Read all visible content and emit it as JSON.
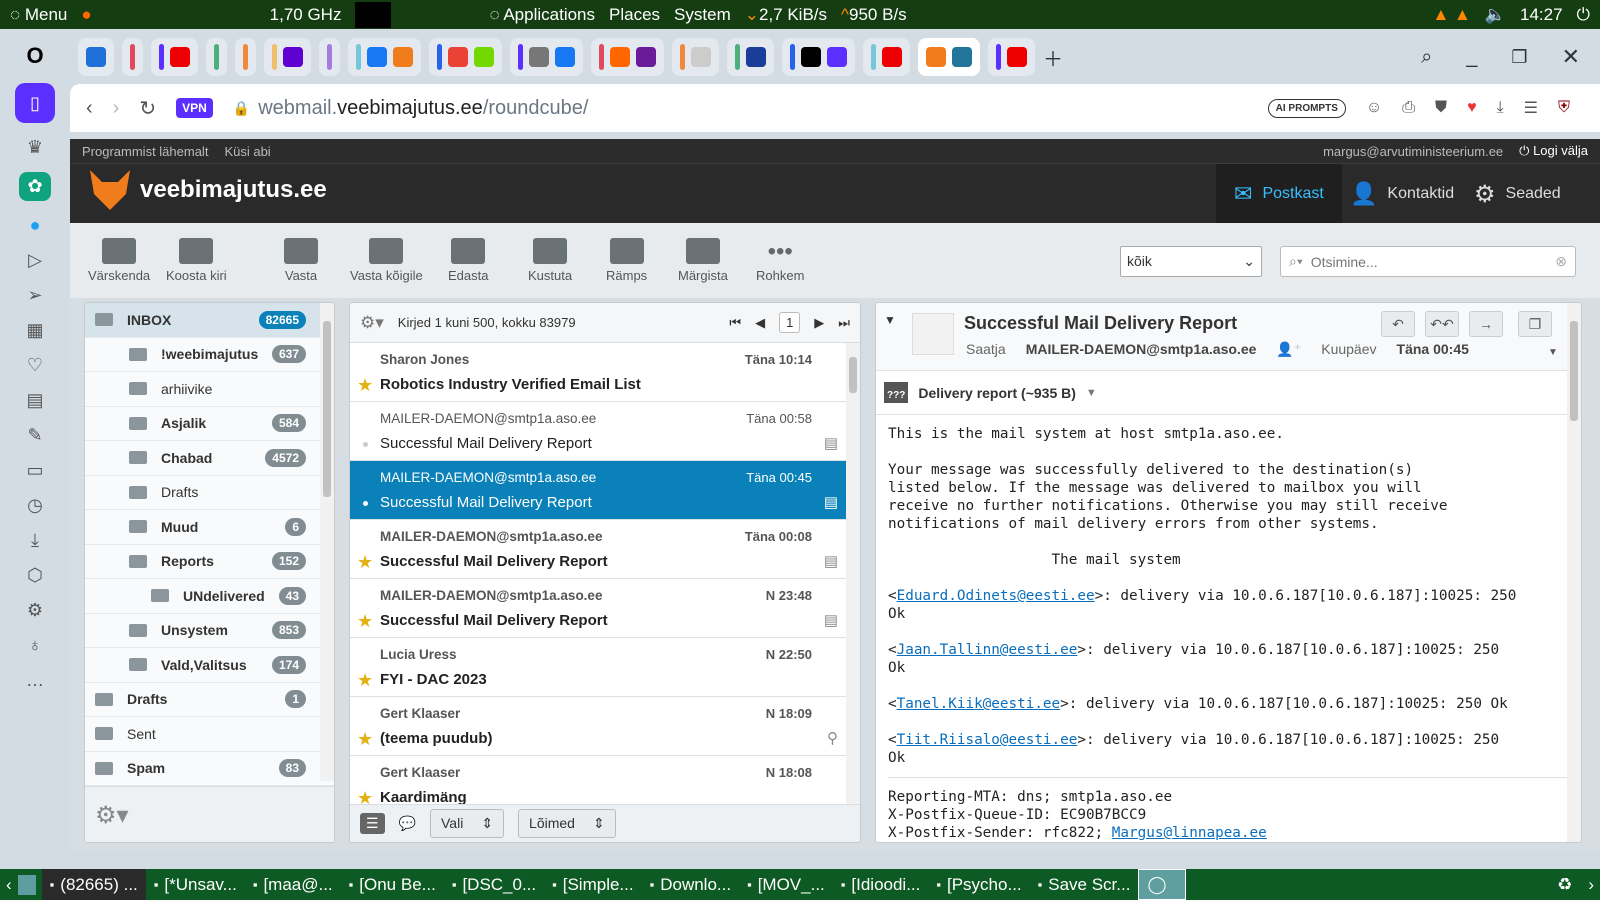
{
  "top_panel": {
    "menu": "Menu",
    "cpu": "1,70 GHz",
    "applications": "Applications",
    "places": "Places",
    "system": "System",
    "net": "2,7 KiB/s",
    "up": "950 B/s",
    "clock": "14:27"
  },
  "browser": {
    "vpn": "VPN",
    "url_pre": "webmail.",
    "url_host": "veebimajutus.ee",
    "url_path": "/roundcube/",
    "ai_prompts": "AI PROMPTS"
  },
  "rc_top": {
    "about": "Programmist lähemalt",
    "help": "Küsi abi",
    "user": "margus@arvutiministeerium.ee",
    "logout": "Logi välja"
  },
  "header": {
    "logo": "veebimajutus.ee",
    "nav": [
      "Postkast",
      "Kontaktid",
      "Seaded"
    ]
  },
  "toolbar": {
    "buttons": [
      "Värskenda",
      "Koosta kiri",
      "Vasta",
      "Vasta kõigile",
      "Edasta",
      "Kustuta",
      "Rämps",
      "Märgista",
      "Rohkem"
    ],
    "filter": "kõik",
    "search_placeholder": "Otsimine..."
  },
  "folders": [
    {
      "name": "INBOX",
      "count": "82665"
    },
    {
      "name": "!weebimajutus",
      "count": "637"
    },
    {
      "name": "arhiivike",
      "count": ""
    },
    {
      "name": "Asjalik",
      "count": "584"
    },
    {
      "name": "Chabad",
      "count": "4572"
    },
    {
      "name": "Drafts",
      "count": ""
    },
    {
      "name": "Muud",
      "count": "6"
    },
    {
      "name": "Reports",
      "count": "152"
    },
    {
      "name": "UNdelivered",
      "count": "43"
    },
    {
      "name": "Unsystem",
      "count": "853"
    },
    {
      "name": "Vald,Valitsus",
      "count": "174"
    },
    {
      "name": "Drafts",
      "count": "1"
    },
    {
      "name": "Sent",
      "count": ""
    },
    {
      "name": "Spam",
      "count": "83"
    }
  ],
  "list": {
    "summary": "Kirjed 1 kuni 500, kokku 83979",
    "page": "1",
    "select": "Vali",
    "threads": "Lõimed",
    "messages": [
      {
        "from": "Sharon Jones",
        "date": "Täna 10:14",
        "subject": "Robotics Industry Verified Email List"
      },
      {
        "from": "MAILER-DAEMON@smtp1a.aso.ee",
        "date": "Täna 00:58",
        "subject": "Successful Mail Delivery Report"
      },
      {
        "from": "MAILER-DAEMON@smtp1a.aso.ee",
        "date": "Täna 00:45",
        "subject": "Successful Mail Delivery Report"
      },
      {
        "from": "MAILER-DAEMON@smtp1a.aso.ee",
        "date": "Täna 00:08",
        "subject": "Successful Mail Delivery Report"
      },
      {
        "from": "MAILER-DAEMON@smtp1a.aso.ee",
        "date": "N 23:48",
        "subject": "Successful Mail Delivery Report"
      },
      {
        "from": "Lucia Uress",
        "date": "N 22:50",
        "subject": "FYI - DAC 2023"
      },
      {
        "from": "Gert Klaaser",
        "date": "N 18:09",
        "subject": "(teema puudub)"
      },
      {
        "from": "Gert Klaaser",
        "date": "N 18:08",
        "subject": "Kaardimäng"
      }
    ]
  },
  "preview": {
    "subject": "Successful Mail Delivery Report",
    "from_label": "Saatja",
    "from": "MAILER-DAEMON@smtp1a.aso.ee",
    "date_label": "Kuupäev",
    "date": "Täna 00:45",
    "attachment": "Delivery report (~935 B)",
    "body1": "This is the mail system at host smtp1a.aso.ee.\n\nYour message was successfully delivered to the destination(s)\nlisted below. If the message was delivered to mailbox you will\nreceive no further notifications. Otherwise you may still receive\nnotifications of mail delivery errors from other systems.\n\n                   The mail system\n",
    "recipients": [
      {
        "addr": "Eduard.Odinets@eesti.ee",
        "rest": ">: delivery via 10.0.6.187[10.0.6.187]:10025: 250\nOk"
      },
      {
        "addr": "Jaan.Tallinn@eesti.ee",
        "rest": ">: delivery via 10.0.6.187[10.0.6.187]:10025: 250\nOk"
      },
      {
        "addr": "Tanel.Kiik@eesti.ee",
        "rest": ">: delivery via 10.0.6.187[10.0.6.187]:10025: 250 Ok"
      },
      {
        "addr": "Tiit.Riisalo@eesti.ee",
        "rest": ">: delivery via 10.0.6.187[10.0.6.187]:10025: 250\nOk"
      }
    ],
    "body2": "Reporting-MTA: dns; smtp1a.aso.ee\nX-Postfix-Queue-ID: EC90B7BCC9\nX-Postfix-Sender: rfc822; ",
    "sender_link": "Margus@linnapea.ee"
  },
  "taskbar": [
    "(82665) ...",
    "[*Unsav...",
    "[maa@...",
    "[Onu Be...",
    "[DSC_0...",
    "[Simple...",
    "Downlo...",
    "[MOV_...",
    "[Idioodi...",
    "[Psycho...",
    "Save Scr..."
  ]
}
